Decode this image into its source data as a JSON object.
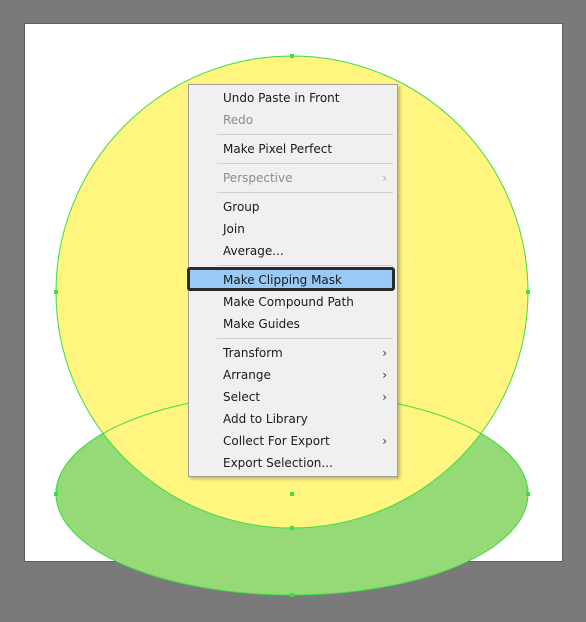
{
  "menu": {
    "items": [
      {
        "label": "Undo Paste in Front",
        "disabled": false,
        "submenu": false
      },
      {
        "label": "Redo",
        "disabled": true,
        "submenu": false
      },
      {
        "label": "Make Pixel Perfect",
        "disabled": false,
        "submenu": false
      },
      {
        "label": "Perspective",
        "disabled": true,
        "submenu": true
      },
      {
        "label": "Group",
        "disabled": false,
        "submenu": false
      },
      {
        "label": "Join",
        "disabled": false,
        "submenu": false
      },
      {
        "label": "Average...",
        "disabled": false,
        "submenu": false
      },
      {
        "label": "Make Clipping Mask",
        "disabled": false,
        "submenu": false,
        "highlighted": true
      },
      {
        "label": "Make Compound Path",
        "disabled": false,
        "submenu": false
      },
      {
        "label": "Make Guides",
        "disabled": false,
        "submenu": false
      },
      {
        "label": "Transform",
        "disabled": false,
        "submenu": true
      },
      {
        "label": "Arrange",
        "disabled": false,
        "submenu": true
      },
      {
        "label": "Select",
        "disabled": false,
        "submenu": true
      },
      {
        "label": "Add to Library",
        "disabled": false,
        "submenu": false
      },
      {
        "label": "Collect For Export",
        "disabled": false,
        "submenu": true
      },
      {
        "label": "Export Selection...",
        "disabled": false,
        "submenu": false
      }
    ],
    "submenu_arrow": "›"
  },
  "colors": {
    "pasteboard": "#7a7a7a",
    "artboard": "#ffffff",
    "yellow_circle": "#fff57f",
    "green_ellipse": "#96d977",
    "selection": "#3ddc4a",
    "highlight": "#99c9f5"
  },
  "icons": {
    "submenu": "chevron-right-icon"
  }
}
